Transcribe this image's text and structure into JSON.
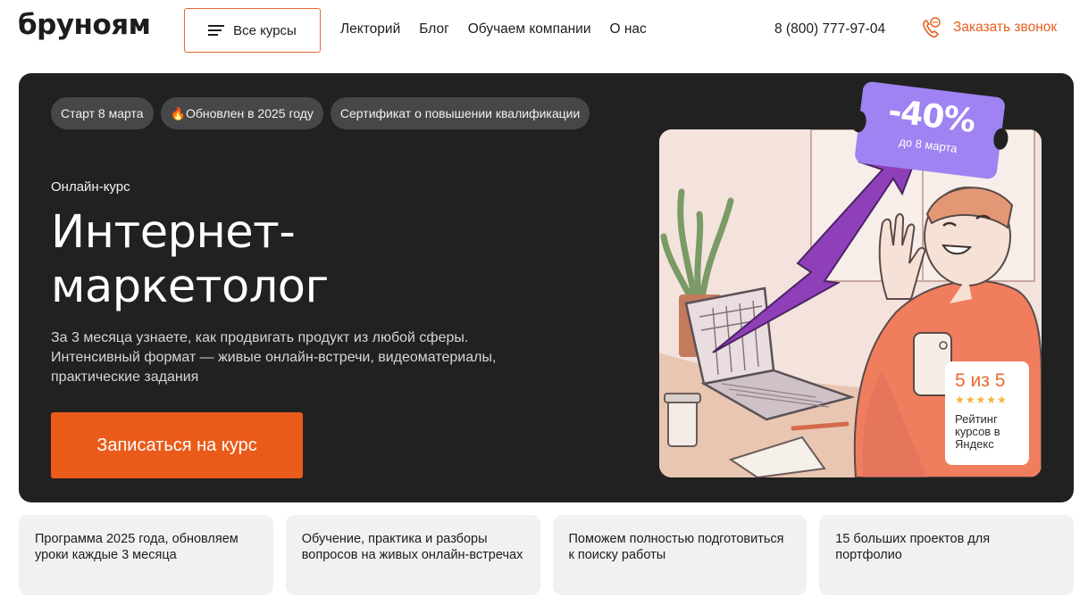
{
  "header": {
    "logo": "бруноям",
    "courses_button": "Все курсы",
    "nav": [
      "Лекторий",
      "Блог",
      "Обучаем компании",
      "О нас"
    ],
    "phone": "8 (800) 777-97-04",
    "callback": "Заказать звонок"
  },
  "hero": {
    "chips": [
      "Старт 8 марта",
      "🔥Обновлен в 2025 году",
      "Сертификат о повышении квалификации"
    ],
    "kicker": "Онлайн-курс",
    "title_line1": "Интернет-",
    "title_line2": "маркетолог",
    "description": "За 3 месяца узнаете, как продвигать продукт из любой сферы. Интенсивный формат — живые онлайн-встречи, видеоматериалы, практические задания",
    "cta": "Записаться на курс",
    "discount": {
      "percent": "-40%",
      "until": "до 8 марта"
    },
    "rating": {
      "score": "5 из 5",
      "stars": "★★★★★",
      "label": "Рейтинг курсов в Яндекс",
      "value": 5,
      "max": 5
    }
  },
  "features": [
    "Программа 2025 года, обновляем уроки каждые 3 месяца",
    "Обучение, практика и разборы вопросов на живых онлайн-встречах",
    "Поможем полностью подготовиться к поиску работы",
    "15 больших проектов для портфолио"
  ],
  "colors": {
    "accent": "#ea5b1a",
    "hero_bg": "#212121",
    "badge": "#9f83f2",
    "star": "#f2b53a"
  }
}
